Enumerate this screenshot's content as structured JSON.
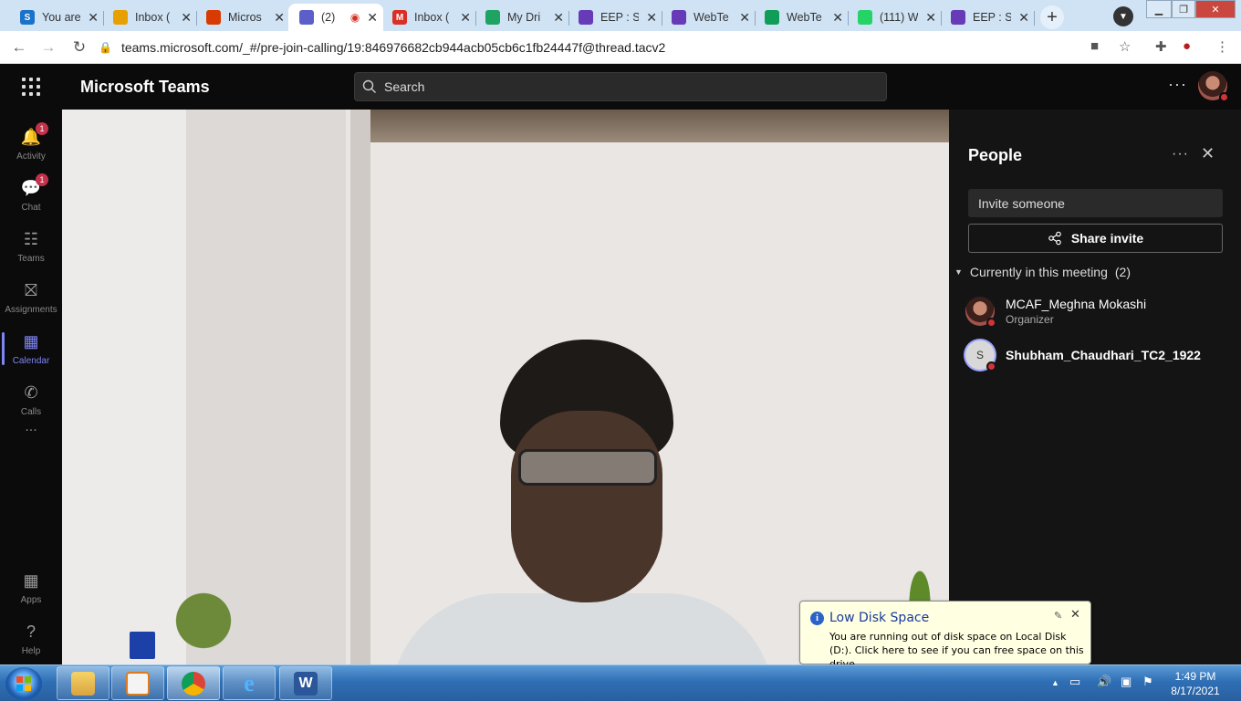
{
  "browser": {
    "tabs": [
      {
        "title": "You are",
        "favicon": "sway-icon",
        "color": "#1a73c9",
        "letter": "S",
        "active": false
      },
      {
        "title": "Inbox (",
        "favicon": "mail-icon",
        "color": "#e8a000",
        "letter": "",
        "active": false
      },
      {
        "title": "Micros",
        "favicon": "office-icon",
        "color": "#d83b01",
        "letter": "",
        "active": false
      },
      {
        "title": "(2)",
        "favicon": "teams-icon",
        "color": "#5b5fc7",
        "letter": "",
        "active": true
      },
      {
        "title": "Inbox (",
        "favicon": "gmail-icon",
        "color": "#d93025",
        "letter": "M",
        "active": false
      },
      {
        "title": "My Dri",
        "favicon": "drive-icon",
        "color": "#1ea362",
        "letter": "",
        "active": false
      },
      {
        "title": "EEP : St",
        "favicon": "forms-icon",
        "color": "#673ab7",
        "letter": "",
        "active": false
      },
      {
        "title": "WebTe",
        "favicon": "forms-icon",
        "color": "#673ab7",
        "letter": "",
        "active": false
      },
      {
        "title": "WebTe",
        "favicon": "sheets-icon",
        "color": "#0f9d58",
        "letter": "",
        "active": false
      },
      {
        "title": "(111) W",
        "favicon": "whatsapp-icon",
        "color": "#25d366",
        "letter": "",
        "active": false
      },
      {
        "title": "EEP : St",
        "favicon": "forms-icon",
        "color": "#673ab7",
        "letter": "",
        "active": false
      }
    ],
    "url": "teams.microsoft.com/_#/pre-join-calling/19:846976682cb944acb05cb6c1fb24447f@thread.tacv2"
  },
  "teams": {
    "app_title": "Microsoft Teams",
    "search_placeholder": "Search"
  },
  "rail": {
    "items": [
      {
        "label": "Activity",
        "icon": "bell-icon",
        "badge": "1",
        "active": false
      },
      {
        "label": "Chat",
        "icon": "chat-icon",
        "badge": "1",
        "active": false
      },
      {
        "label": "Teams",
        "icon": "teams-group-icon",
        "badge": "",
        "active": false
      },
      {
        "label": "Assignments",
        "icon": "backpack-icon",
        "badge": "",
        "active": false
      },
      {
        "label": "Calendar",
        "icon": "calendar-icon",
        "badge": "",
        "active": true
      },
      {
        "label": "Calls",
        "icon": "phone-icon",
        "badge": "",
        "active": false
      }
    ],
    "more": "...",
    "bottom": [
      {
        "label": "Apps",
        "icon": "apps-icon"
      },
      {
        "label": "Help",
        "icon": "help-icon"
      }
    ]
  },
  "people": {
    "title": "People",
    "invite_placeholder": "Invite someone",
    "share_label": "Share invite",
    "section_label": "Currently in this meeting",
    "section_count": "(2)",
    "participants": [
      {
        "name": "MCAF_Meghna Mokashi",
        "role": "Organizer",
        "initial": ""
      },
      {
        "name": "Shubham_Chaudhari_TC2_1922",
        "role": "",
        "initial": "S"
      }
    ]
  },
  "notification": {
    "title": "Low Disk Space",
    "message": "You are running out of disk space on Local Disk (D:). Click here to see if you can free space on this drive."
  },
  "taskbar": {
    "apps": [
      "explorer-icon",
      "media-player-icon",
      "chrome-icon",
      "internet-explorer-icon",
      "word-icon"
    ],
    "time": "1:49 PM",
    "date": "8/17/2021"
  }
}
